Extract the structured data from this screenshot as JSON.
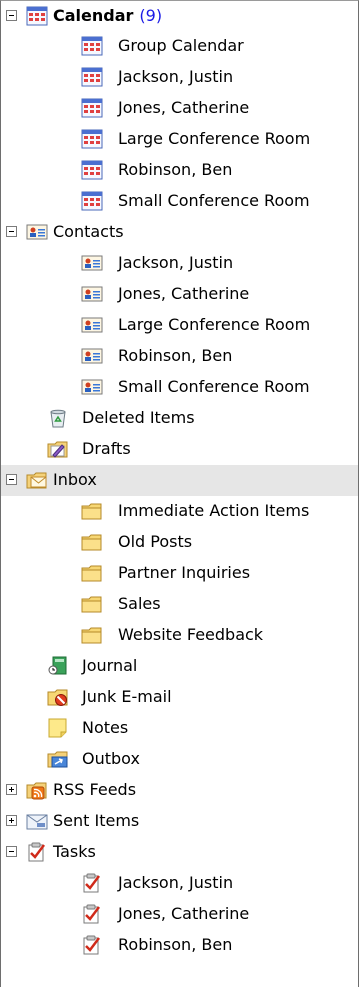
{
  "tree": {
    "calendar": {
      "label": "Calendar",
      "count": "(9)",
      "children": [
        "Group Calendar",
        "Jackson, Justin",
        "Jones, Catherine",
        "Large Conference Room",
        "Robinson, Ben",
        "Small Conference Room"
      ]
    },
    "contacts": {
      "label": "Contacts",
      "children": [
        "Jackson, Justin",
        "Jones, Catherine",
        "Large Conference Room",
        "Robinson, Ben",
        "Small Conference Room"
      ]
    },
    "deleted_items": "Deleted Items",
    "drafts": "Drafts",
    "inbox": {
      "label": "Inbox",
      "children": [
        "Immediate Action Items",
        "Old Posts",
        "Partner Inquiries",
        "Sales",
        "Website Feedback"
      ]
    },
    "journal": "Journal",
    "junk_email": "Junk E-mail",
    "notes": "Notes",
    "outbox": "Outbox",
    "rss_feeds": "RSS Feeds",
    "sent_items": "Sent Items",
    "tasks": {
      "label": "Tasks",
      "children": [
        "Jackson, Justin",
        "Jones, Catherine",
        "Robinson, Ben"
      ]
    }
  },
  "colors": {
    "count": "#1a1ae6",
    "selected_row": "#e6e6e6"
  }
}
